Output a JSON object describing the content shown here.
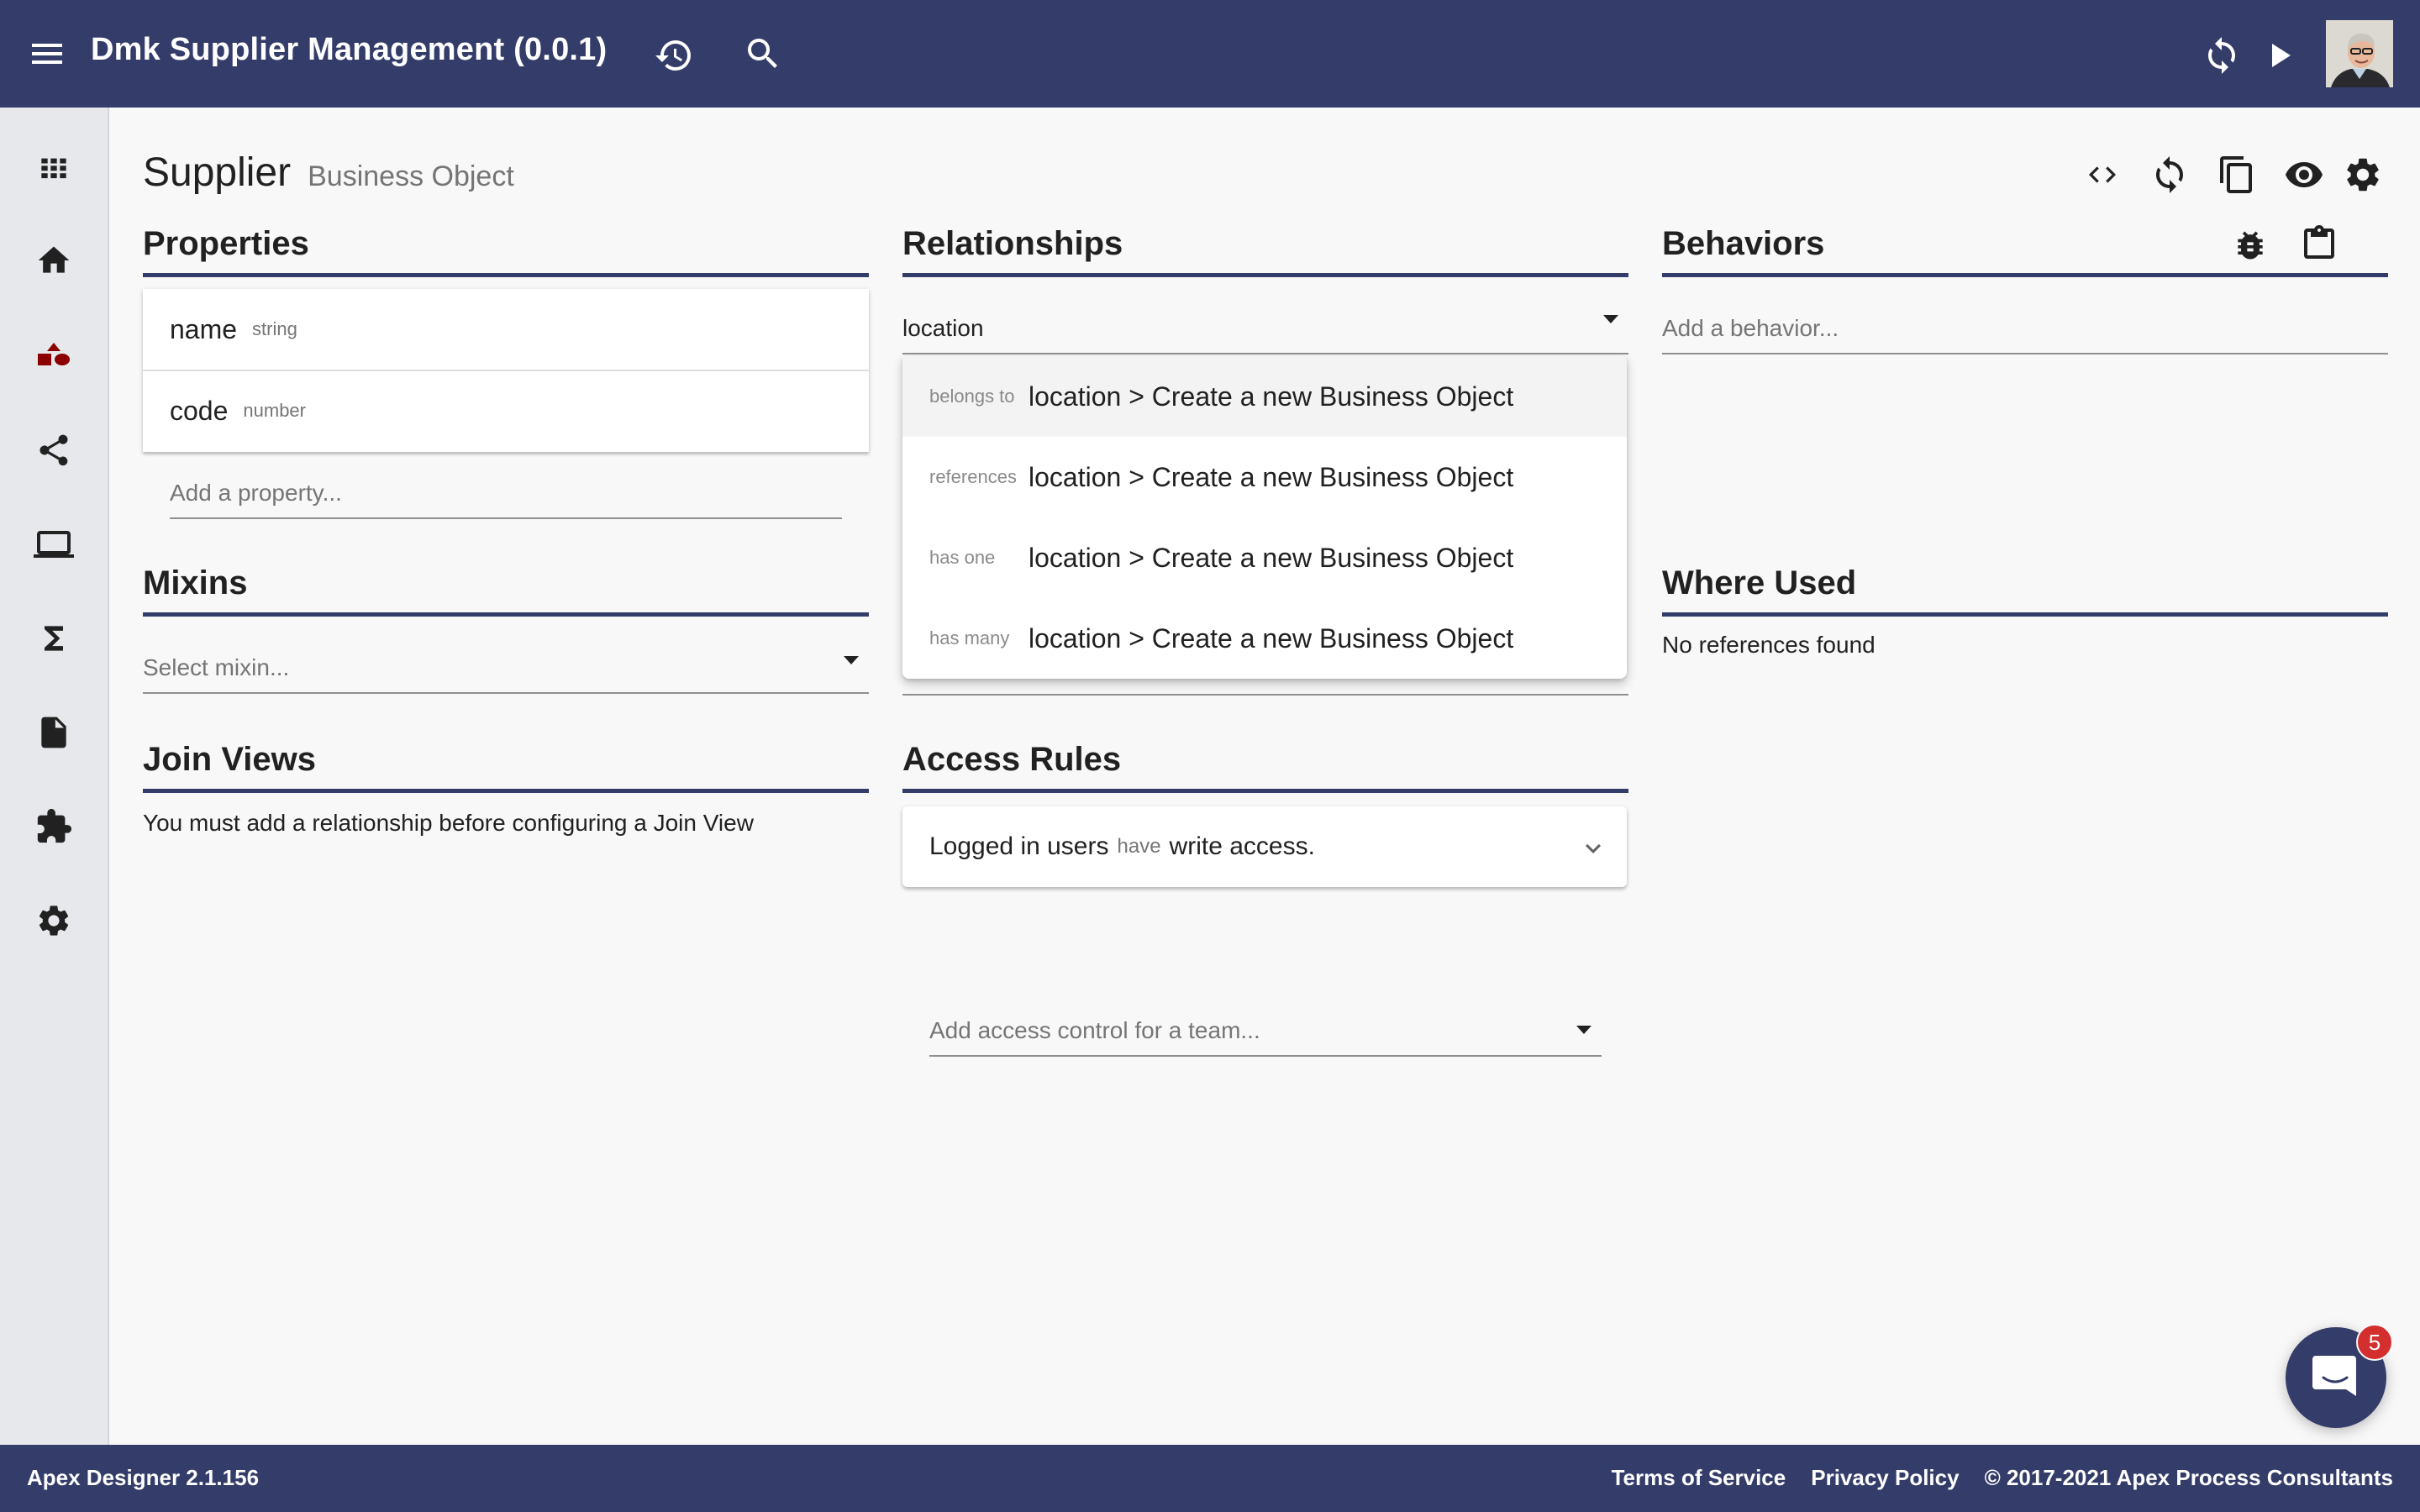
{
  "app": {
    "title": "Dmk Supplier Management (0.0.1)",
    "icons": {
      "menu": "menu-icon",
      "history": "history-icon",
      "search": "search-icon",
      "sync": "sync-icon",
      "run": "play-icon",
      "avatar": "user-avatar"
    }
  },
  "sidebar": {
    "items": [
      {
        "name": "apps",
        "icon": "apps-grid-icon"
      },
      {
        "name": "home",
        "icon": "home-icon"
      },
      {
        "name": "business-objects",
        "icon": "shapes-icon",
        "active": true,
        "color": "#8b0000"
      },
      {
        "name": "relationships",
        "icon": "share-icon"
      },
      {
        "name": "user-interfaces",
        "icon": "laptop-icon"
      },
      {
        "name": "processes",
        "icon": "sigma-icon"
      },
      {
        "name": "files",
        "icon": "file-icon"
      },
      {
        "name": "dependencies",
        "icon": "puzzle-icon"
      },
      {
        "name": "settings",
        "icon": "gear-icon"
      }
    ]
  },
  "page": {
    "object_name": "Supplier",
    "object_type": "Business Object",
    "actions": [
      "code-icon",
      "sync-icon",
      "copy-icon",
      "eye-icon",
      "gear-icon"
    ]
  },
  "properties": {
    "title": "Properties",
    "items": [
      {
        "name": "name",
        "type": "string"
      },
      {
        "name": "code",
        "type": "number"
      }
    ],
    "add_placeholder": "Add a property..."
  },
  "mixins": {
    "title": "Mixins",
    "placeholder": "Select mixin..."
  },
  "join_views": {
    "title": "Join Views",
    "message": "You must add a relationship before configuring a Join View"
  },
  "relationships": {
    "title": "Relationships",
    "input_value": "location",
    "options": [
      {
        "kind": "belongs to",
        "label": "location > Create a new Business Object"
      },
      {
        "kind": "references",
        "label": "location > Create a new Business Object"
      },
      {
        "kind": "has one",
        "label": "location > Create a new Business Object"
      },
      {
        "kind": "has many",
        "label": "location > Create a new Business Object"
      }
    ]
  },
  "access_rules": {
    "title": "Access Rules",
    "rules": [
      {
        "who": "Logged in users",
        "verb": "have",
        "what": "write access."
      }
    ],
    "add_placeholder": "Add access control for a team..."
  },
  "behaviors": {
    "title": "Behaviors",
    "placeholder": "Add a behavior...",
    "actions": [
      "bug-icon",
      "clipboard-icon"
    ]
  },
  "where_used": {
    "title": "Where Used",
    "message": "No references found"
  },
  "footer": {
    "version": "Apex Designer 2.1.156",
    "terms": "Terms of Service",
    "privacy": "Privacy Policy",
    "copyright": "© 2017-2021 Apex Process Consultants"
  },
  "chat": {
    "unread_count": "5"
  },
  "colors": {
    "brand": "#343c6a",
    "active_nav": "#8b0000",
    "badge": "#d32f2f"
  }
}
